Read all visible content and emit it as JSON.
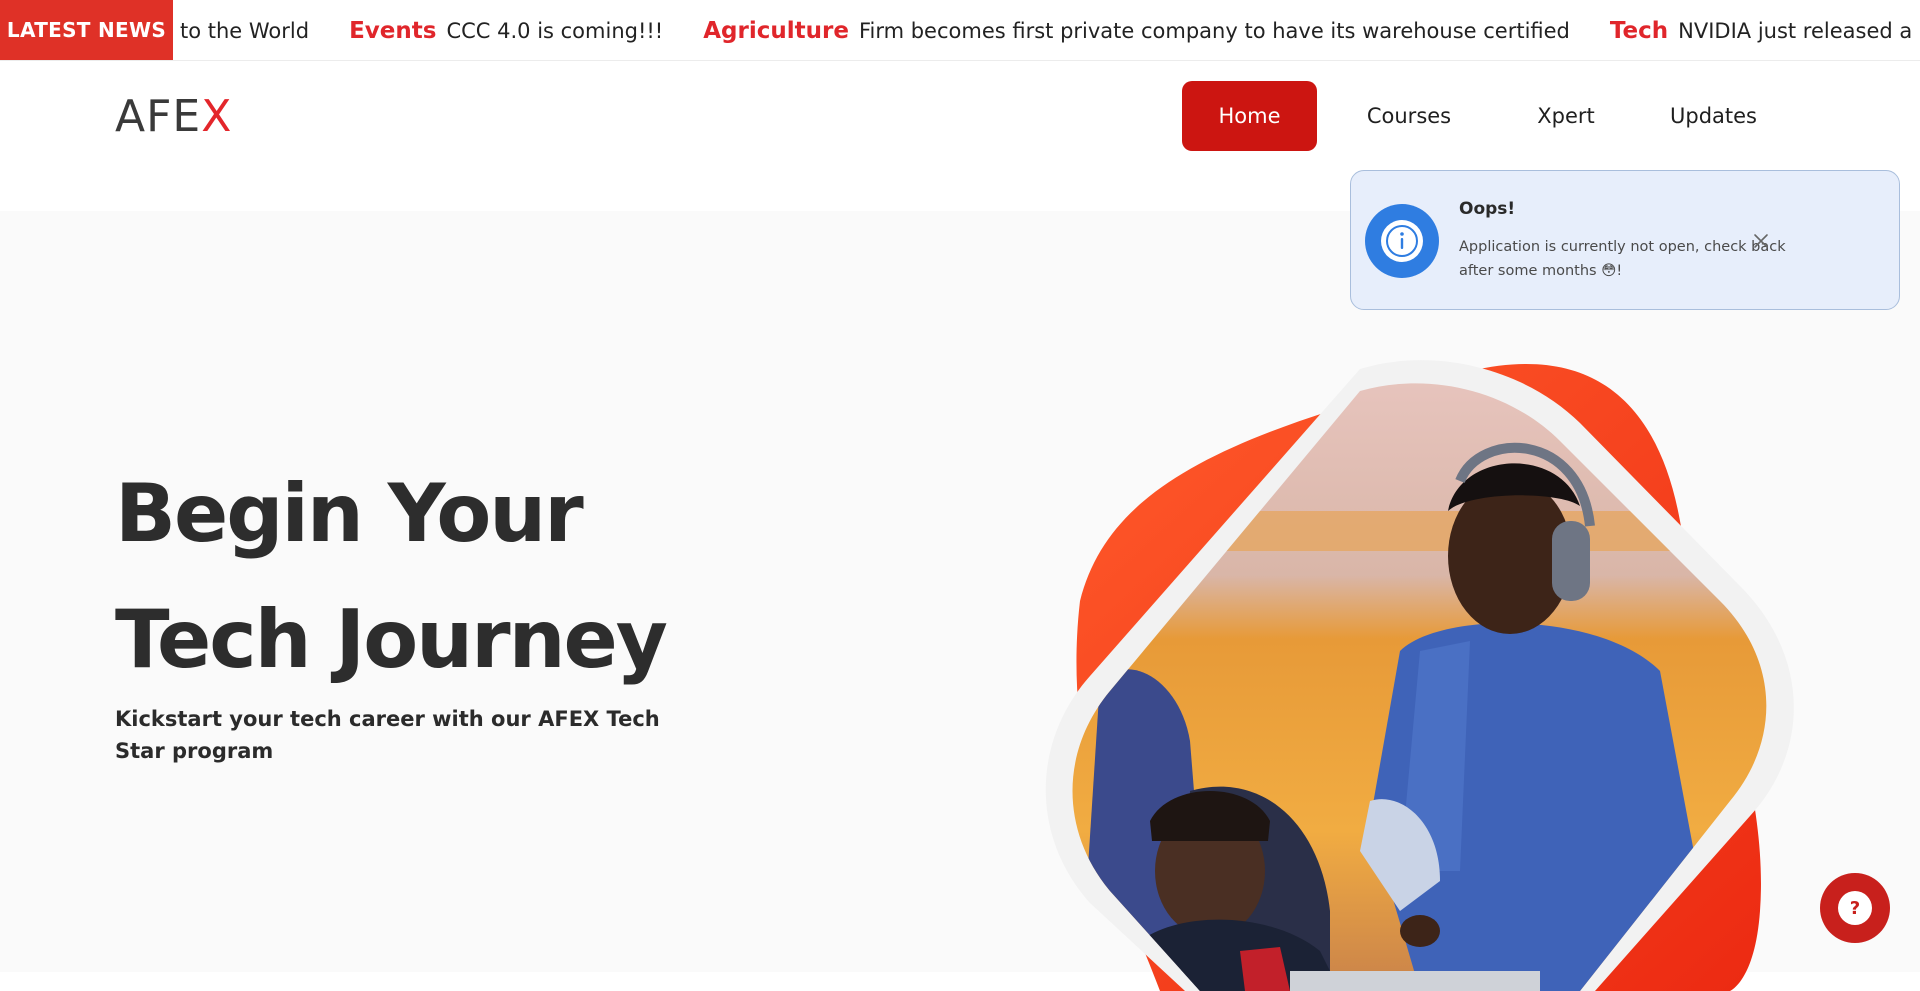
{
  "ticker": {
    "badge": "LATEST NEWS",
    "lead_text": "to the World",
    "items": [
      {
        "category": "Events",
        "text": "CCC 4.0 is coming!!!"
      },
      {
        "category": "Agriculture",
        "text": "Firm becomes first private company to have its warehouse certified"
      },
      {
        "category": "Tech",
        "text": "NVIDIA just released a new Eye Contact feature"
      }
    ]
  },
  "header": {
    "logo_main": "AFE",
    "logo_x": "X",
    "nav": [
      "Home",
      "Courses",
      "Xpert",
      "Updates"
    ],
    "active_nav": "Home"
  },
  "hero": {
    "title_line1": "Begin Your",
    "title_line2": "Tech Journey",
    "subtitle": "Kickstart your tech career with our AFEX Tech Star program"
  },
  "toast": {
    "title": "Oops!",
    "message": "Application is currently not open, check back after some months 😳!",
    "icon": "info-icon",
    "close_icon": "close-icon"
  },
  "help": {
    "label": "?",
    "icon": "help-icon"
  },
  "colors": {
    "brand_red": "#cc1511",
    "ticker_category": "#e0262b",
    "toast_bg": "#e7eefb",
    "toast_icon": "#2f7de1"
  }
}
